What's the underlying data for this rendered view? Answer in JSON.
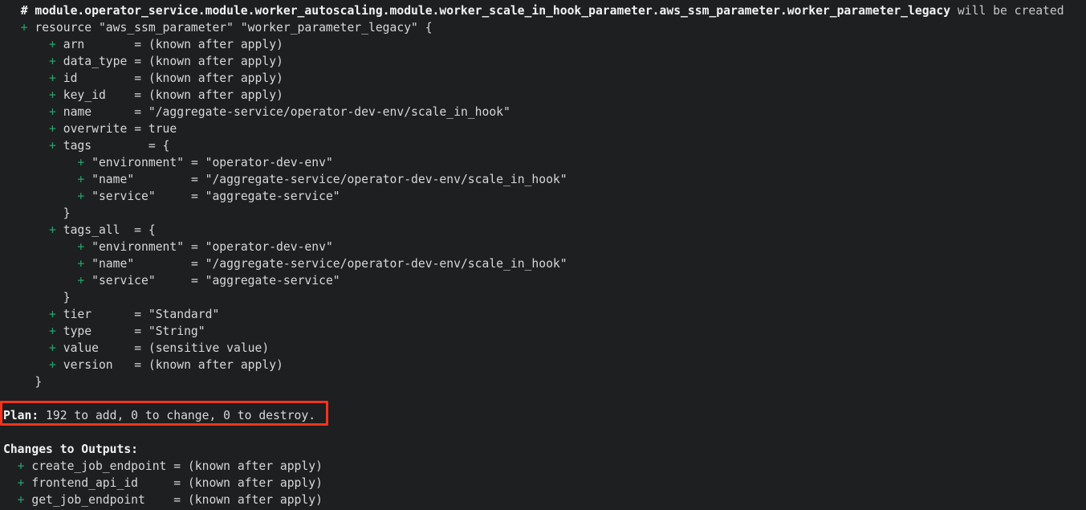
{
  "terminal": {
    "title": "terraform plan output",
    "background_color": "#1d1f21",
    "text_color": "#d8d8d8",
    "add_marker_color": "#29a36a",
    "highlight_box_color": "#f4331c"
  },
  "resource_header": {
    "comment_marker": "#",
    "address": "module.operator_service.module.worker_autoscaling.module.worker_scale_in_hook_parameter.aws_ssm_parameter.worker_parameter_legacy",
    "action_text": "will be created",
    "full_line": "  # module.operator_service.module.worker_autoscaling.module.worker_scale_in_hook_parameter.aws_ssm_parameter.worker_parameter_legacy will be created"
  },
  "resource_block": {
    "open_line": "  + resource \"aws_ssm_parameter\" \"worker_parameter_legacy\" {",
    "resource_type": "aws_ssm_parameter",
    "resource_name": "worker_parameter_legacy",
    "close_line": "    }",
    "attributes": [
      {
        "marker": "+",
        "key": "arn",
        "pad": "       ",
        "eq": "=",
        "value": "(known after apply)"
      },
      {
        "marker": "+",
        "key": "data_type",
        "pad": " ",
        "eq": "=",
        "value": "(known after apply)"
      },
      {
        "marker": "+",
        "key": "id",
        "pad": "        ",
        "eq": "=",
        "value": "(known after apply)"
      },
      {
        "marker": "+",
        "key": "key_id",
        "pad": "    ",
        "eq": "=",
        "value": "(known after apply)"
      },
      {
        "marker": "+",
        "key": "name",
        "pad": "      ",
        "eq": "=",
        "value": "\"/aggregate-service/operator-dev-env/scale_in_hook\""
      },
      {
        "marker": "+",
        "key": "overwrite",
        "pad": " ",
        "eq": "=",
        "value": "true"
      },
      {
        "marker": "+",
        "key": "tier",
        "pad": "      ",
        "eq": "=",
        "value": "\"Standard\""
      },
      {
        "marker": "+",
        "key": "type",
        "pad": "      ",
        "eq": "=",
        "value": "\"String\""
      },
      {
        "marker": "+",
        "key": "value",
        "pad": "     ",
        "eq": "=",
        "value": "(sensitive value)"
      },
      {
        "marker": "+",
        "key": "version",
        "pad": "   ",
        "eq": "=",
        "value": "(known after apply)"
      }
    ],
    "tags_block": {
      "open_line": "      + tags        = {",
      "close_line": "        }",
      "entries": [
        {
          "key": "\"environment\"",
          "value": "\"operator-dev-env\""
        },
        {
          "key": "\"name\"",
          "value": "\"/aggregate-service/operator-dev-env/scale_in_hook\""
        },
        {
          "key": "\"service\"",
          "value": "\"aggregate-service\""
        }
      ]
    },
    "tags_all_block": {
      "open_line": "      + tags_all  = {",
      "close_line": "        }",
      "entries": [
        {
          "key": "\"environment\"",
          "value": "\"operator-dev-env\""
        },
        {
          "key": "\"name\"",
          "value": "\"/aggregate-service/operator-dev-env/scale_in_hook\""
        },
        {
          "key": "\"service\"",
          "value": "\"aggregate-service\""
        }
      ]
    }
  },
  "plan_summary": {
    "label": "Plan:",
    "to_add": "192",
    "to_change": "0",
    "to_destroy": "0",
    "text": " 192 to add, 0 to change, 0 to destroy."
  },
  "outputs_section": {
    "heading": "Changes to Outputs:",
    "items": [
      {
        "marker": "+",
        "name": "create_job_endpoint",
        "pad": " ",
        "eq": "=",
        "value": "(known after apply)"
      },
      {
        "marker": "+",
        "name": "frontend_api_id",
        "pad": "     ",
        "eq": "=",
        "value": "(known after apply)"
      },
      {
        "marker": "+",
        "name": "get_job_endpoint",
        "pad": "    ",
        "eq": "=",
        "value": "(known after apply)"
      }
    ]
  },
  "lines": [
    {
      "id": "l1",
      "type": "header"
    },
    {
      "id": "l2",
      "type": "resource-open"
    },
    {
      "id": "l3",
      "type": "attr",
      "index": 0
    },
    {
      "id": "l4",
      "type": "attr",
      "index": 1
    },
    {
      "id": "l5",
      "type": "attr",
      "index": 2
    },
    {
      "id": "l6",
      "type": "attr",
      "index": 3
    },
    {
      "id": "l7",
      "type": "attr",
      "index": 4
    },
    {
      "id": "l8",
      "type": "attr",
      "index": 5
    },
    {
      "id": "l9",
      "type": "tags-open"
    },
    {
      "id": "l10",
      "type": "tags-entry",
      "index": 0
    },
    {
      "id": "l11",
      "type": "tags-entry",
      "index": 1
    },
    {
      "id": "l12",
      "type": "tags-entry",
      "index": 2
    },
    {
      "id": "l13",
      "type": "tags-close"
    },
    {
      "id": "l14",
      "type": "tagsall-open"
    },
    {
      "id": "l15",
      "type": "tagsall-entry",
      "index": 0
    },
    {
      "id": "l16",
      "type": "tagsall-entry",
      "index": 1
    },
    {
      "id": "l17",
      "type": "tagsall-entry",
      "index": 2
    },
    {
      "id": "l18",
      "type": "tagsall-close"
    },
    {
      "id": "l19",
      "type": "attr",
      "index": 6
    },
    {
      "id": "l20",
      "type": "attr",
      "index": 7
    },
    {
      "id": "l21",
      "type": "attr",
      "index": 8
    },
    {
      "id": "l22",
      "type": "attr",
      "index": 9
    },
    {
      "id": "l23",
      "type": "resource-close"
    },
    {
      "id": "l24",
      "type": "blank"
    },
    {
      "id": "l25",
      "type": "plan"
    },
    {
      "id": "l26",
      "type": "blank"
    },
    {
      "id": "l27",
      "type": "outputs-heading"
    },
    {
      "id": "l28",
      "type": "output",
      "index": 0
    },
    {
      "id": "l29",
      "type": "output",
      "index": 1
    },
    {
      "id": "l30",
      "type": "output",
      "index": 2
    }
  ]
}
